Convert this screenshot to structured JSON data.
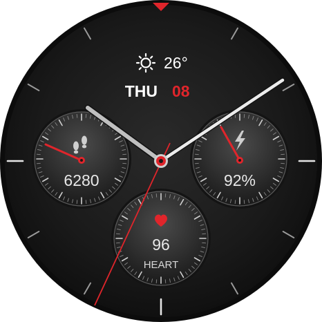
{
  "weather": {
    "icon": "sun-icon",
    "temperature": "26°"
  },
  "date": {
    "weekday": "THU",
    "day": "08"
  },
  "complications": {
    "steps": {
      "icon": "footprints-icon",
      "value": "6280"
    },
    "battery": {
      "icon": "lightning-icon",
      "value": "92%"
    },
    "heart": {
      "icon": "heart-icon",
      "value": "96",
      "label": "HEART"
    }
  },
  "colors": {
    "accent": "#e0252b",
    "background": "#161616",
    "text": "#ffffff"
  }
}
